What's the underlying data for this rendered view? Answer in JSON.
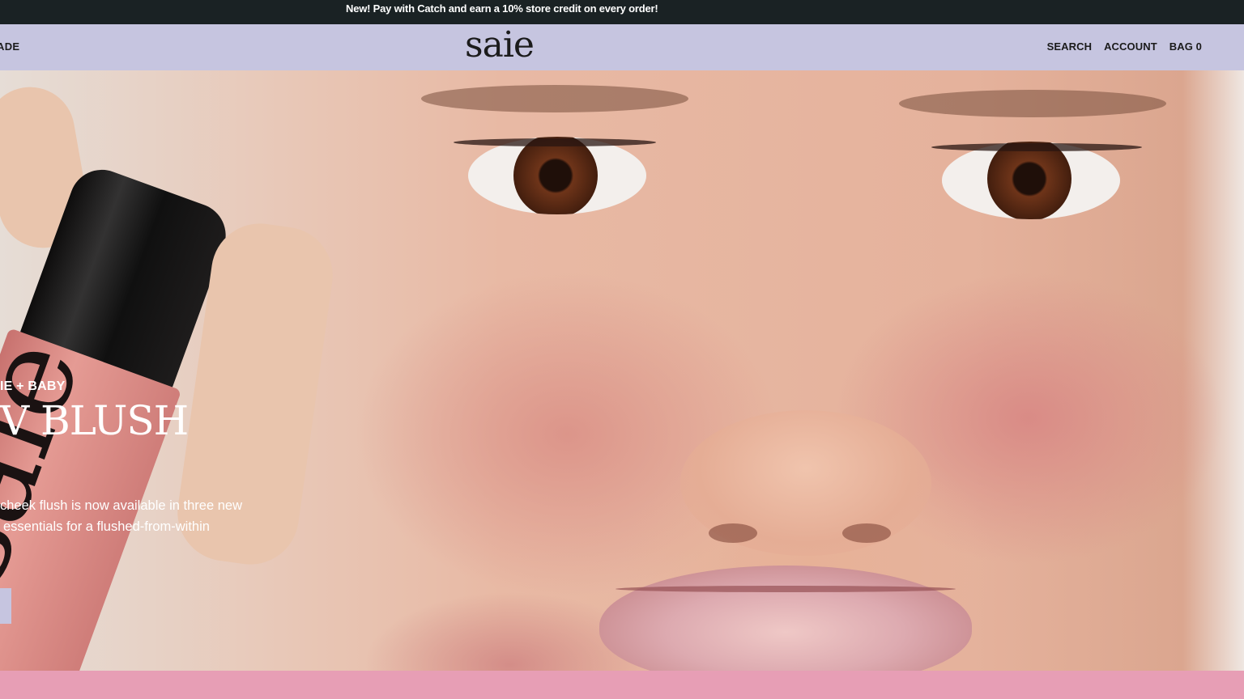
{
  "announcement": {
    "text": "New! Pay with Catch and earn a 10%  store credit on every order!"
  },
  "header": {
    "left_nav": "ADE",
    "logo": "saie",
    "right_nav": {
      "search": "SEARCH",
      "account": "ACCOUNT",
      "bag": "BAG 0"
    }
  },
  "hero": {
    "eyebrow": "IE + BABY",
    "headline": "V BLUSH",
    "description_line1": "cheek flush is now available in three new",
    "description_line2": "essentials for a flushed-from-within",
    "bottle_logo": "saie"
  },
  "colors": {
    "announcement_bg": "#1a2224",
    "header_bg": "#c6c5e0",
    "footer_strip": "#e79eb5",
    "cta_bg": "#c6c5e0"
  }
}
